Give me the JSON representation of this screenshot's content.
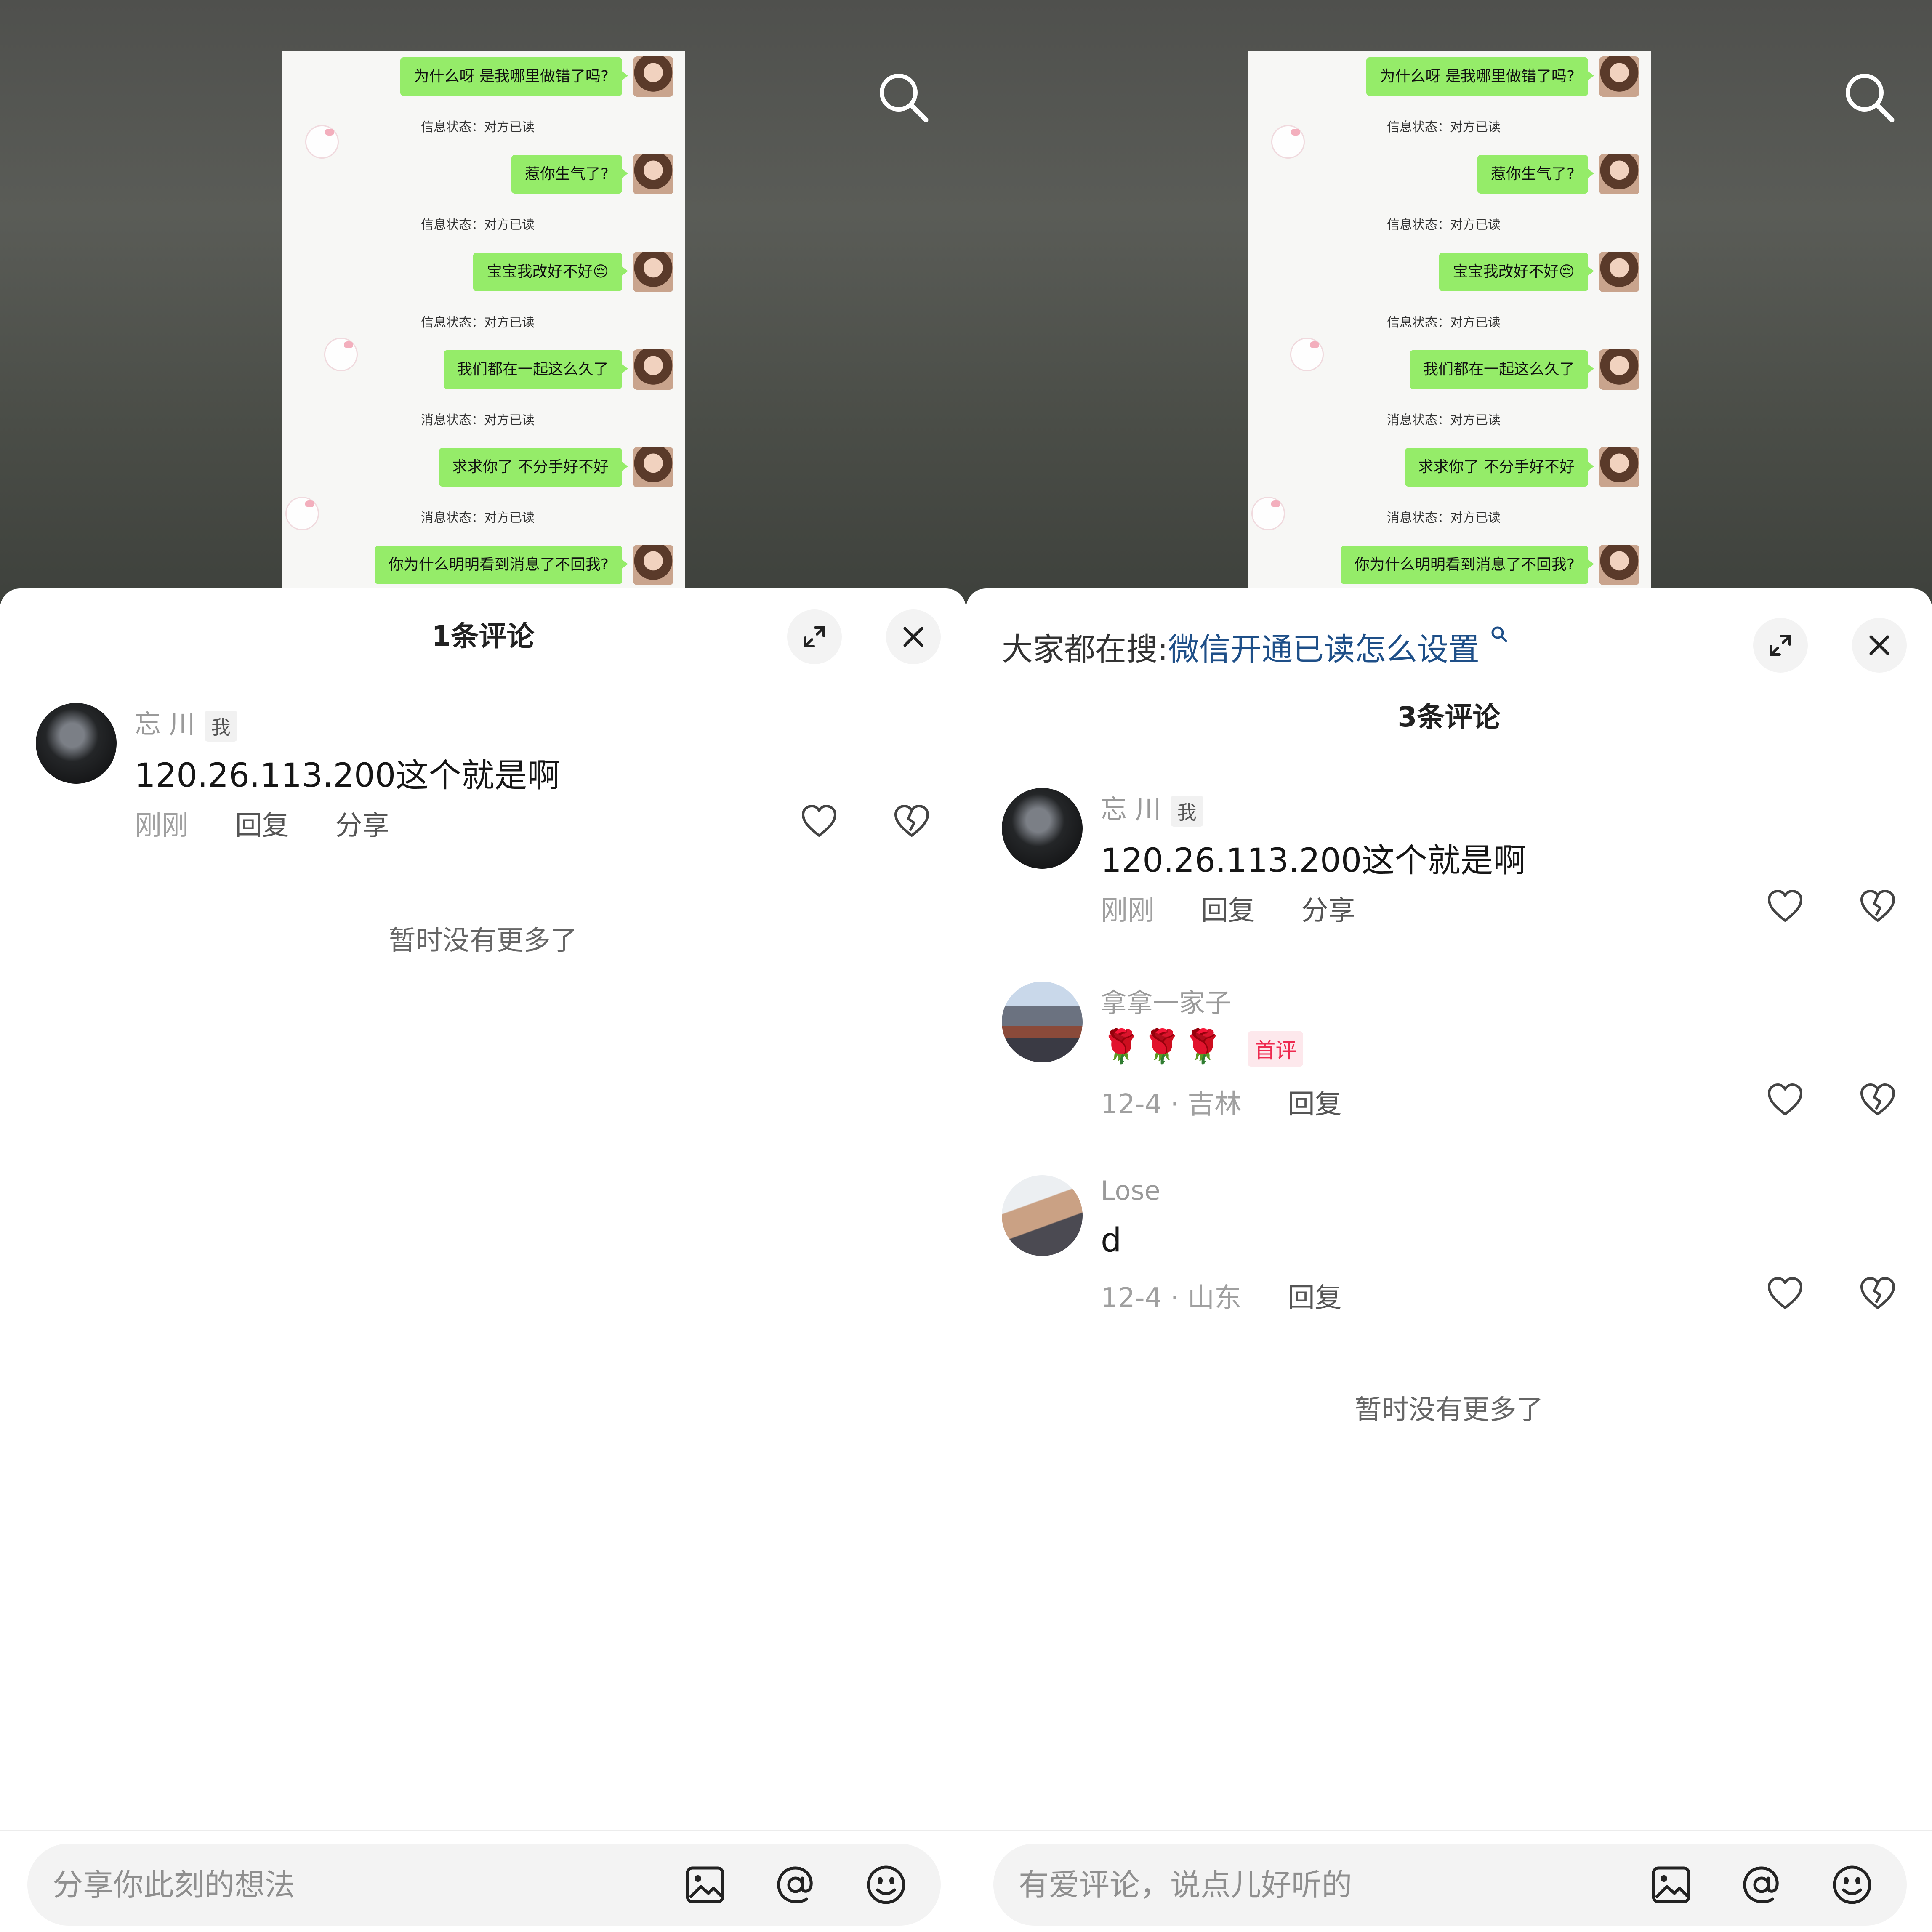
{
  "chat_screenshot": {
    "messages": [
      {
        "text": "为什么呀 是我哪里做错了吗?",
        "status": "信息状态：对方已读"
      },
      {
        "text": "惹你生气了?",
        "status": "信息状态：对方已读"
      },
      {
        "text": "宝宝我改好不好😔",
        "status": "信息状态：对方已读"
      },
      {
        "text": "我们都在一起这么久了",
        "status": "消息状态：对方已读"
      },
      {
        "text": "求求你了 不分手好不好",
        "status": "消息状态：对方已读"
      },
      {
        "text": "你为什么明明看到消息了不回我?",
        "status": ""
      }
    ]
  },
  "left": {
    "title": "1条评论",
    "comments": [
      {
        "user": "忘 川",
        "tag": "我",
        "text": "120.26.113.200这个就是啊",
        "time": "刚刚",
        "reply": "回复",
        "share": "分享"
      }
    ],
    "end_text": "暂时没有更多了",
    "input_placeholder": "分享你此刻的想法"
  },
  "right": {
    "search_prefix": "大家都在搜:",
    "search_link": "微信开通已读怎么设置",
    "title": "3条评论",
    "comments": [
      {
        "user": "忘 川",
        "tag": "我",
        "text": "120.26.113.200这个就是啊",
        "time": "刚刚",
        "reply": "回复",
        "share": "分享"
      },
      {
        "user": "拿拿一家子",
        "text": "🌹🌹🌹",
        "badge": "首评",
        "time": "12-4 · 吉林",
        "reply": "回复"
      },
      {
        "user": "Lose",
        "text": "d",
        "time": "12-4 · 山东",
        "reply": "回复"
      }
    ],
    "end_text": "暂时没有更多了",
    "input_placeholder": "有爱评论，说点儿好听的"
  },
  "icons": {
    "search": "search-icon",
    "expand": "expand-icon",
    "close": "close-icon",
    "like": "heart-icon",
    "dislike": "broken-heart-icon",
    "image": "image-icon",
    "mention": "at-icon",
    "emoji": "emoji-icon"
  },
  "colors": {
    "bubble": "#95ec69",
    "link": "#1e4f88",
    "first_badge_text": "#ee2a50",
    "first_badge_bg": "#fde8ec"
  }
}
